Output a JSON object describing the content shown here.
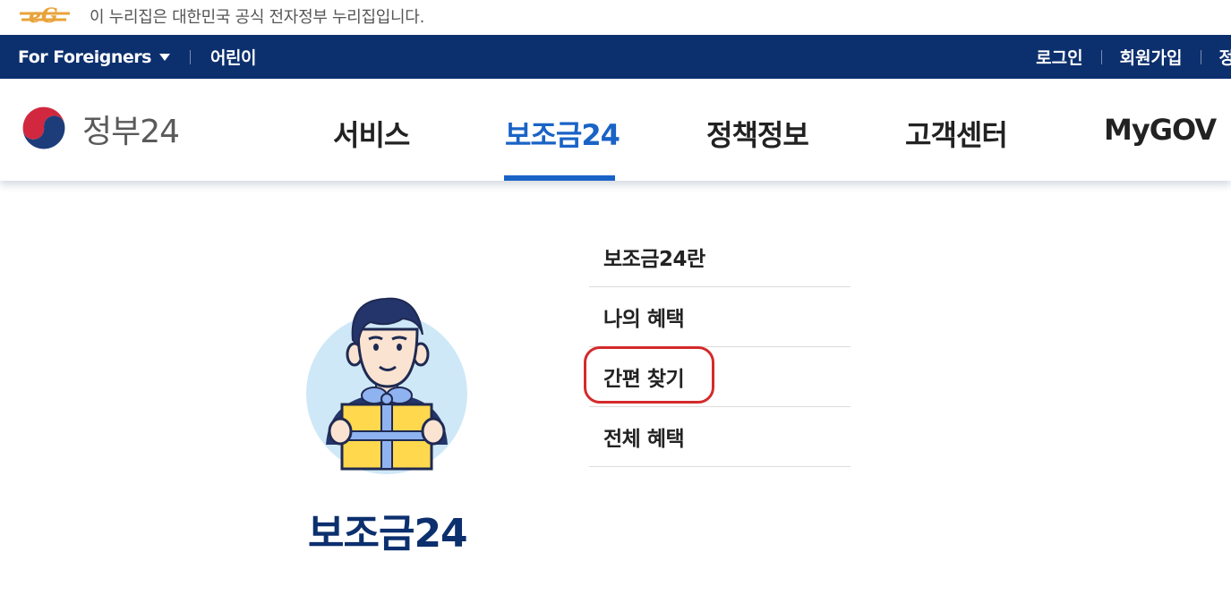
{
  "notice": {
    "logo_text": "eG",
    "text": "이 누리집은 대한민국 공식 전자정부 누리집입니다."
  },
  "utility": {
    "foreigners_label": "For Foreigners",
    "kids_label": "어린이",
    "login_label": "로그인",
    "signup_label": "회원가입",
    "partial_label": "정"
  },
  "header": {
    "logo_text": "정부24",
    "nav": [
      {
        "label": "서비스",
        "active": false
      },
      {
        "label": "보조금24",
        "active": true
      },
      {
        "label": "정책정보",
        "active": false
      },
      {
        "label": "고객센터",
        "active": false
      },
      {
        "label": "MyGOV",
        "active": false
      }
    ]
  },
  "megamenu": {
    "title": "보조금24",
    "items": [
      {
        "label": "보조금24란"
      },
      {
        "label": "나의 혜택"
      },
      {
        "label": "간편 찾기",
        "highlighted": true
      },
      {
        "label": "전체 혜택"
      }
    ]
  },
  "colors": {
    "navy": "#0c2f6e",
    "accent_blue": "#1a63c6",
    "highlight_red": "#d42a2a"
  }
}
